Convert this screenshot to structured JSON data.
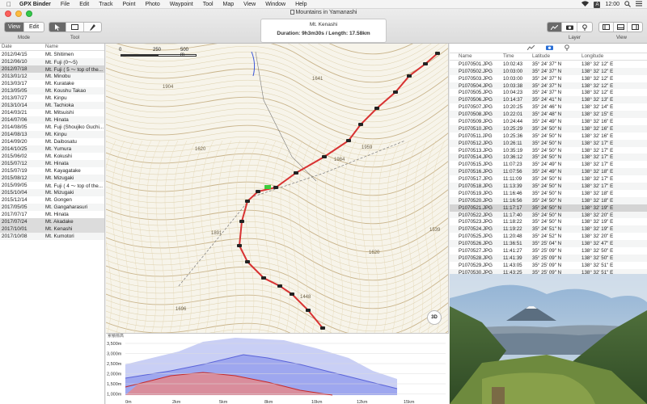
{
  "menubar": {
    "app": "GPX Binder",
    "items": [
      "File",
      "Edit",
      "Track",
      "Point",
      "Photo",
      "Waypoint",
      "Tool",
      "Map",
      "View",
      "Window",
      "Help"
    ],
    "clock": "12:00"
  },
  "window": {
    "title": "Mountains in Yamanashi"
  },
  "status": {
    "line1": "Mt. Kenashi",
    "line2": "Duration: 9h3m30s  /  Length: 17.58km"
  },
  "toolbar": {
    "view": "View",
    "edit": "Edit",
    "mode_label": "Mode",
    "tool_label": "Tool",
    "layer_label": "Layer",
    "view_label": "View"
  },
  "sidebar": {
    "col_date": "Date",
    "col_name": "Name",
    "selected_index": 2,
    "rows": [
      [
        "2012/04/15",
        "Mt. Shitimen"
      ],
      [
        "2012/06/10",
        "Mt. Fuji (0〜5)"
      ],
      [
        "2012/07/18",
        "Mt. Fuji ( 5 〜 top of the..."
      ],
      [
        "2013/01/12",
        "Mt. Minobu"
      ],
      [
        "2013/03/17",
        "Mt. Kuratake"
      ],
      [
        "2013/05/05",
        "Mt. Koushu Takao"
      ],
      [
        "2013/07/27",
        "Mt. Kinpu"
      ],
      [
        "2013/10/14",
        "Mt. Tachioka"
      ],
      [
        "2014/03/21",
        "Mt. Mitsuishi"
      ],
      [
        "2014/07/06",
        "Mt. Hinata"
      ],
      [
        "2014/08/05",
        "Mt. Fuji (Shoujiko Guchi..."
      ],
      [
        "2014/08/13",
        "Mt. Kinpu"
      ],
      [
        "2014/09/20",
        "Mt. Daibosatu"
      ],
      [
        "2014/10/25",
        "Mt. Yumura"
      ],
      [
        "2015/06/02",
        "Mt. Kokushi"
      ],
      [
        "2015/07/12",
        "Mt. Hinata"
      ],
      [
        "2015/07/19",
        "Mt. Kayagatake"
      ],
      [
        "2015/08/12",
        "Mt. Mizugaki"
      ],
      [
        "2015/09/05",
        "Mt. Fuji ( 4 〜 top of the..."
      ],
      [
        "2015/10/04",
        "Mt. Mizugaki"
      ],
      [
        "2015/12/14",
        "Mt. Gongen"
      ],
      [
        "2017/05/05",
        "Mt. Gangaharasuri"
      ],
      [
        "2017/07/17",
        "Mt. Hinata"
      ],
      [
        "2017/07/24",
        "Mt. Akadake"
      ],
      [
        "2017/10/01",
        "Mt. Kenashi"
      ],
      [
        "2017/10/08",
        "Mt. Kumotori"
      ]
    ],
    "highlight_indices": [
      23,
      24
    ]
  },
  "map": {
    "scale": {
      "s0": "0",
      "s1": "250",
      "s2": "500 m"
    },
    "btn3d": "3D",
    "contours": [
      "1904",
      "1641",
      "1620",
      "1959",
      "1984",
      "1891",
      "1620",
      "1539",
      "1696",
      "1448"
    ]
  },
  "profile": {
    "ylabels": [
      "3,500m",
      "3,000m",
      "2,500m",
      "2,000m",
      "1,500m",
      "1,000m"
    ],
    "xlabels": [
      "0m",
      "2km",
      "5km",
      "8km",
      "10km",
      "12km",
      "15km"
    ],
    "top_label": "累積標高"
  },
  "photos": {
    "cols": [
      "Name",
      "Time",
      "Latitude",
      "Longitude"
    ],
    "selected_index": 20,
    "rows": [
      [
        "P1070501.JPG",
        "10:02:43",
        "35° 24' 37\" N",
        "138° 32' 12\" E"
      ],
      [
        "P1070502.JPG",
        "10:03:00",
        "35° 24' 37\" N",
        "138° 32' 12\" E"
      ],
      [
        "P1070503.JPG",
        "10:03:00",
        "35° 24' 37\" N",
        "138° 32' 12\" E"
      ],
      [
        "P1070504.JPG",
        "10:03:38",
        "35° 24' 37\" N",
        "138° 32' 12\" E"
      ],
      [
        "P1070505.JPG",
        "10:04:23",
        "35° 24' 37\" N",
        "138° 32' 12\" E"
      ],
      [
        "P1070506.JPG",
        "10:14:37",
        "35° 24' 41\" N",
        "138° 32' 13\" E"
      ],
      [
        "P1070507.JPG",
        "10:20:25",
        "35° 24' 46\" N",
        "138° 32' 14\" E"
      ],
      [
        "P1070508.JPG",
        "10:22:01",
        "35° 24' 48\" N",
        "138° 32' 15\" E"
      ],
      [
        "P1070509.JPG",
        "10:24:44",
        "35° 24' 49\" N",
        "138° 32' 16\" E"
      ],
      [
        "P1070510.JPG",
        "10:25:29",
        "35° 24' 50\" N",
        "138° 32' 16\" E"
      ],
      [
        "P1070511.JPG",
        "10:25:36",
        "35° 24' 50\" N",
        "138° 32' 16\" E"
      ],
      [
        "P1070512.JPG",
        "10:26:11",
        "35° 24' 50\" N",
        "138° 32' 17\" E"
      ],
      [
        "P1070513.JPG",
        "10:35:19",
        "35° 24' 50\" N",
        "138° 32' 17\" E"
      ],
      [
        "P1070514.JPG",
        "10:36:12",
        "35° 24' 50\" N",
        "138° 32' 17\" E"
      ],
      [
        "P1070515.JPG",
        "11:07:23",
        "35° 24' 49\" N",
        "138° 32' 17\" E"
      ],
      [
        "P1070516.JPG",
        "11:07:56",
        "35° 24' 49\" N",
        "138° 32' 18\" E"
      ],
      [
        "P1070517.JPG",
        "11:11:09",
        "35° 24' 50\" N",
        "138° 32' 17\" E"
      ],
      [
        "P1070518.JPG",
        "11:13:39",
        "35° 24' 50\" N",
        "138° 32' 17\" E"
      ],
      [
        "P1070519.JPG",
        "11:16:46",
        "35° 24' 50\" N",
        "138° 32' 18\" E"
      ],
      [
        "P1070520.JPG",
        "11:16:56",
        "35° 24' 50\" N",
        "138° 32' 18\" E"
      ],
      [
        "P1070521.JPG",
        "11:17:17",
        "35° 24' 50\" N",
        "138° 32' 19\" E"
      ],
      [
        "P1070522.JPG",
        "11:17:40",
        "35° 24' 50\" N",
        "138° 32' 20\" E"
      ],
      [
        "P1070523.JPG",
        "11:18:22",
        "35° 24' 50\" N",
        "138° 32' 19\" E"
      ],
      [
        "P1070524.JPG",
        "11:19:22",
        "35° 24' 51\" N",
        "138° 32' 19\" E"
      ],
      [
        "P1070525.JPG",
        "11:20:48",
        "35° 24' 52\" N",
        "138° 32' 20\" E"
      ],
      [
        "P1070526.JPG",
        "11:36:51",
        "35° 25' 04\" N",
        "138° 32' 47\" E"
      ],
      [
        "P1070527.JPG",
        "11:41:27",
        "35° 25' 09\" N",
        "138° 32' 50\" E"
      ],
      [
        "P1070528.JPG",
        "11:41:39",
        "35° 25' 09\" N",
        "138° 32' 50\" E"
      ],
      [
        "P1070529.JPG",
        "11:43:05",
        "35° 25' 09\" N",
        "138° 32' 51\" E"
      ],
      [
        "P1070530.JPG",
        "11:43:25",
        "35° 25' 09\" N",
        "138° 32' 51\" E"
      ]
    ]
  },
  "colors": {
    "track": "#d83232",
    "accent": "#2a6fd6"
  }
}
